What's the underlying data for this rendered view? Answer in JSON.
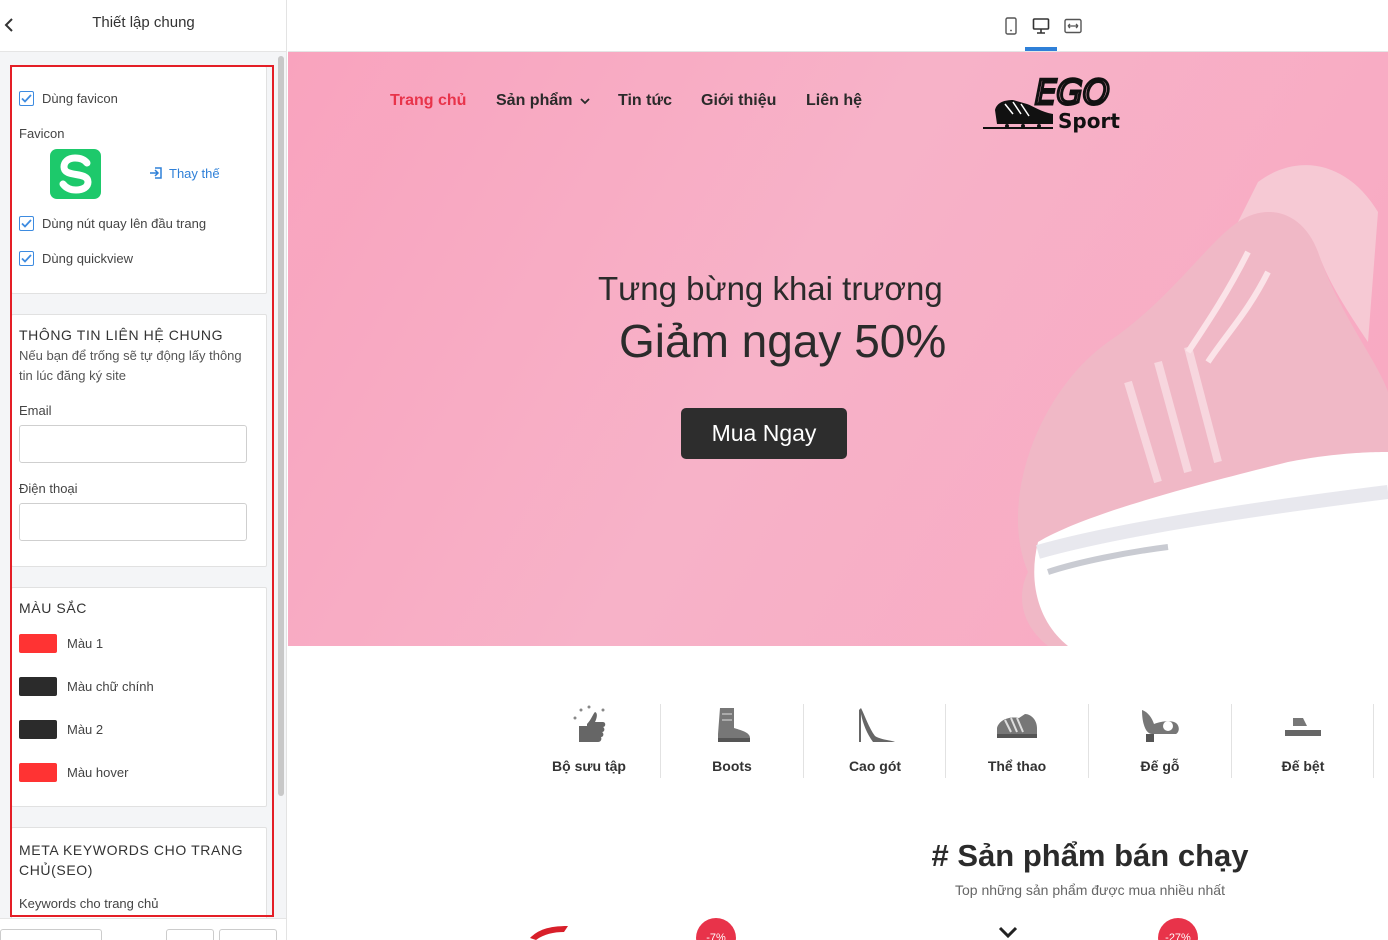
{
  "panel": {
    "title": "Thiết lập chung",
    "general": {
      "use_favicon": "Dùng favicon",
      "favicon_label": "Favicon",
      "replace_label": "Thay thế",
      "use_back_to_top": "Dùng nút quay lên đầu trang",
      "use_quickview": "Dùng quickview"
    },
    "contact": {
      "title": "THÔNG TIN LIÊN HỆ CHUNG",
      "description": "Nếu bạn để trống sẽ tự động lấy thông tin lúc đăng ký site",
      "email_label": "Email",
      "email_value": "",
      "phone_label": "Điện thoại",
      "phone_value": ""
    },
    "colors": {
      "title": "MÀU SẮC",
      "items": [
        {
          "label": "Màu 1",
          "color": "#ff3333"
        },
        {
          "label": "Màu chữ chính",
          "color": "#2b2b2b"
        },
        {
          "label": "Màu 2",
          "color": "#2b2b2b"
        },
        {
          "label": "Màu hover",
          "color": "#ff3333"
        }
      ]
    },
    "seo": {
      "title": "META KEYWORDS CHO TRANG CHỦ(SEO)",
      "keywords_label": "Keywords cho trang chủ"
    }
  },
  "toolbar": {
    "devices": [
      "mobile-icon",
      "desktop-icon",
      "fullwidth-icon"
    ],
    "active_device": "desktop-icon"
  },
  "site": {
    "nav": [
      {
        "label": "Trang chủ",
        "active": true
      },
      {
        "label": "Sản phẩm",
        "dropdown": true
      },
      {
        "label": "Tin tức"
      },
      {
        "label": "Giới thiệu"
      },
      {
        "label": "Liên hệ"
      }
    ],
    "logo_text": {
      "top": "EGO",
      "bottom": "Sport"
    },
    "hero": {
      "line1": "Tưng bừng khai trương",
      "line2": "Giảm ngay 50%",
      "button": "Mua Ngay"
    },
    "categories": [
      {
        "label": "Bộ sưu tập",
        "icon": "collection-icon"
      },
      {
        "label": "Boots",
        "icon": "boot-icon"
      },
      {
        "label": "Cao gót",
        "icon": "high-heel-icon"
      },
      {
        "label": "Thể thao",
        "icon": "sneaker-icon"
      },
      {
        "label": "Đế gỗ",
        "icon": "wooden-sole-icon"
      },
      {
        "label": "Đế bệt",
        "icon": "flat-sandal-icon"
      }
    ],
    "best_sellers": {
      "title": "# Sản phẩm bán chạy",
      "subtitle": "Top những sản phẩm được mua nhiều nhất",
      "badges": [
        "-7%",
        "-27%"
      ]
    }
  },
  "colors": {
    "accent_red": "#e8334a",
    "highlight_border": "#e41e26",
    "link_blue": "#2f80d8",
    "hero_pink": "#f8a8c1"
  }
}
